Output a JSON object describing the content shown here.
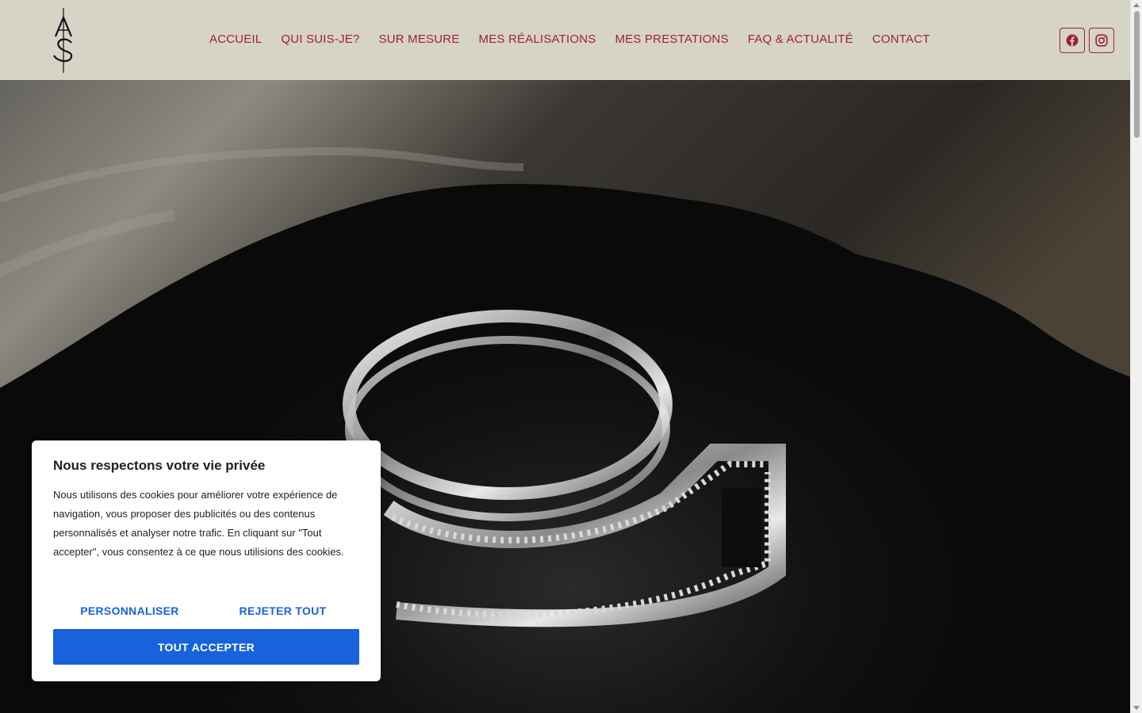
{
  "brand": {
    "logo_icon": "as-monogram-logo",
    "accent_color": "#9e1f3c",
    "header_bg": "#d6d3c7"
  },
  "nav": {
    "items": [
      {
        "label": "ACCUEIL"
      },
      {
        "label": "QUI SUIS-JE?"
      },
      {
        "label": "SUR MESURE"
      },
      {
        "label": "MES RÉALISATIONS"
      },
      {
        "label": "MES PRESTATIONS"
      },
      {
        "label": "FAQ & ACTUALITÉ"
      },
      {
        "label": "CONTACT"
      }
    ]
  },
  "social": {
    "facebook_icon": "facebook-icon",
    "instagram_icon": "instagram-icon"
  },
  "hero": {
    "image": "diamond-ring-on-slate"
  },
  "cookie": {
    "title": "Nous respectons votre vie privée",
    "text": "Nous utilisons des cookies pour améliorer votre expérience de navigation, vous proposer des publicités ou des contenus personnalisés et analyser notre trafic. En cliquant sur \"Tout accepter\", vous consentez à ce que nous utilisions des cookies.",
    "customize_label": "PERSONNALISER",
    "reject_label": "REJETER TOUT",
    "accept_label": "TOUT ACCEPTER",
    "button_color": "#1863dc"
  }
}
